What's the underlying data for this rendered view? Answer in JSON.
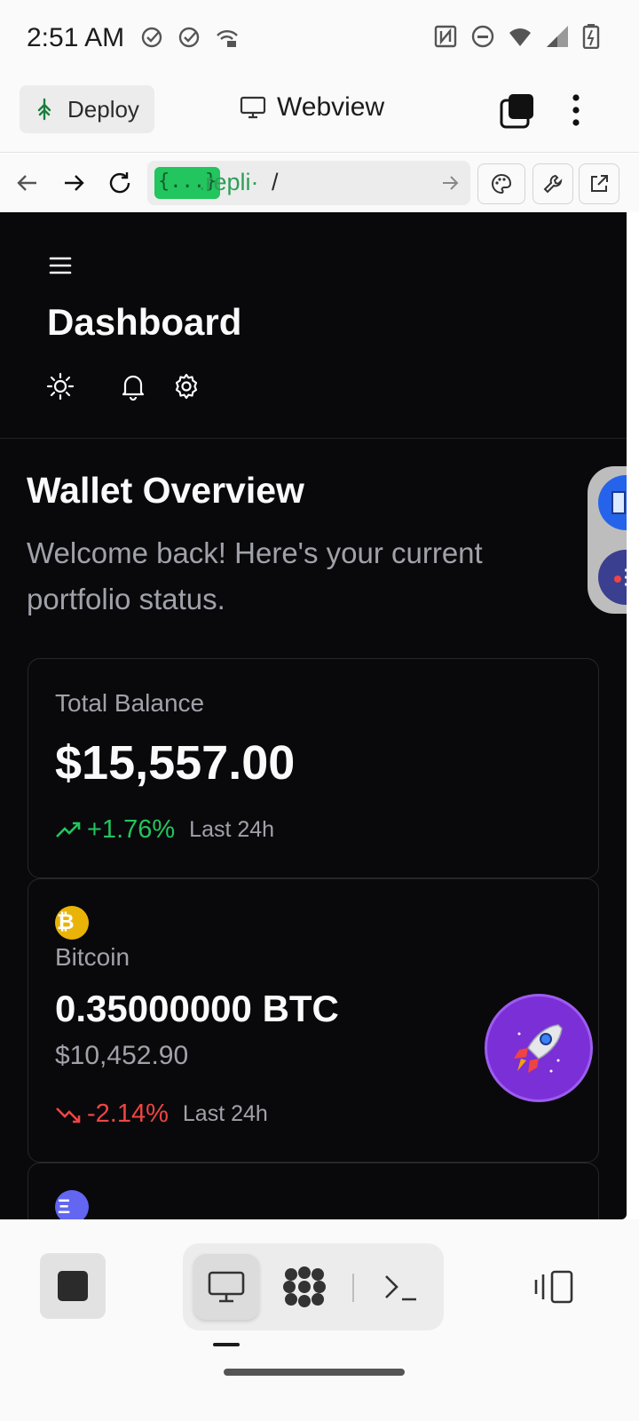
{
  "status_bar": {
    "time": "2:51 AM",
    "left_icons": [
      "check-circle-icon",
      "check-circle-icon",
      "wifi-calling-icon"
    ],
    "right_icons": [
      "nfc-icon",
      "do-not-disturb-icon",
      "wifi-icon",
      "signal-icon",
      "battery-icon"
    ]
  },
  "top_bar": {
    "deploy_label": "Deploy",
    "webview_label": "Webview",
    "icons": [
      "deploy-tree-icon",
      "monitor-icon",
      "tabs-icon",
      "more-vertical-icon"
    ]
  },
  "url_bar": {
    "chip": "{...}",
    "host": ".repli·",
    "path": "/",
    "icons": [
      "back-arrow-icon",
      "forward-arrow-icon",
      "reload-icon",
      "go-arrow-icon",
      "palette-icon",
      "wrench-icon",
      "external-link-icon"
    ]
  },
  "app": {
    "title": "Dashboard",
    "header_icons": [
      "menu-icon",
      "sun-icon",
      "bell-icon",
      "settings-icon"
    ],
    "overview_title": "Wallet Overview",
    "overview_subtitle": "Welcome back! Here's your current portfolio status.",
    "total_card": {
      "label": "Total Balance",
      "value": "$15,557.00",
      "change": "+1.76%",
      "period": "Last 24h",
      "trend": "up"
    },
    "assets": [
      {
        "symbol_glyph": "₿",
        "name": "Bitcoin",
        "amount": "0.35000000 BTC",
        "usd": "$10,452.90",
        "change": "-2.14%",
        "period": "Last 24h",
        "trend": "down",
        "color": "#eab308"
      },
      {
        "symbol_glyph": "Ξ",
        "color": "#6366f1"
      }
    ],
    "floating": [
      "book-icon",
      "list-icon",
      "rocket-icon"
    ]
  },
  "bottom_bar": {
    "icons": [
      "stop-icon",
      "monitor-icon",
      "agent-icon",
      "terminal-icon",
      "panel-toggle-icon"
    ]
  },
  "colors": {
    "background": "#09090b",
    "up": "#22c55e",
    "down": "#ef4444",
    "muted": "#a1a1aa"
  }
}
